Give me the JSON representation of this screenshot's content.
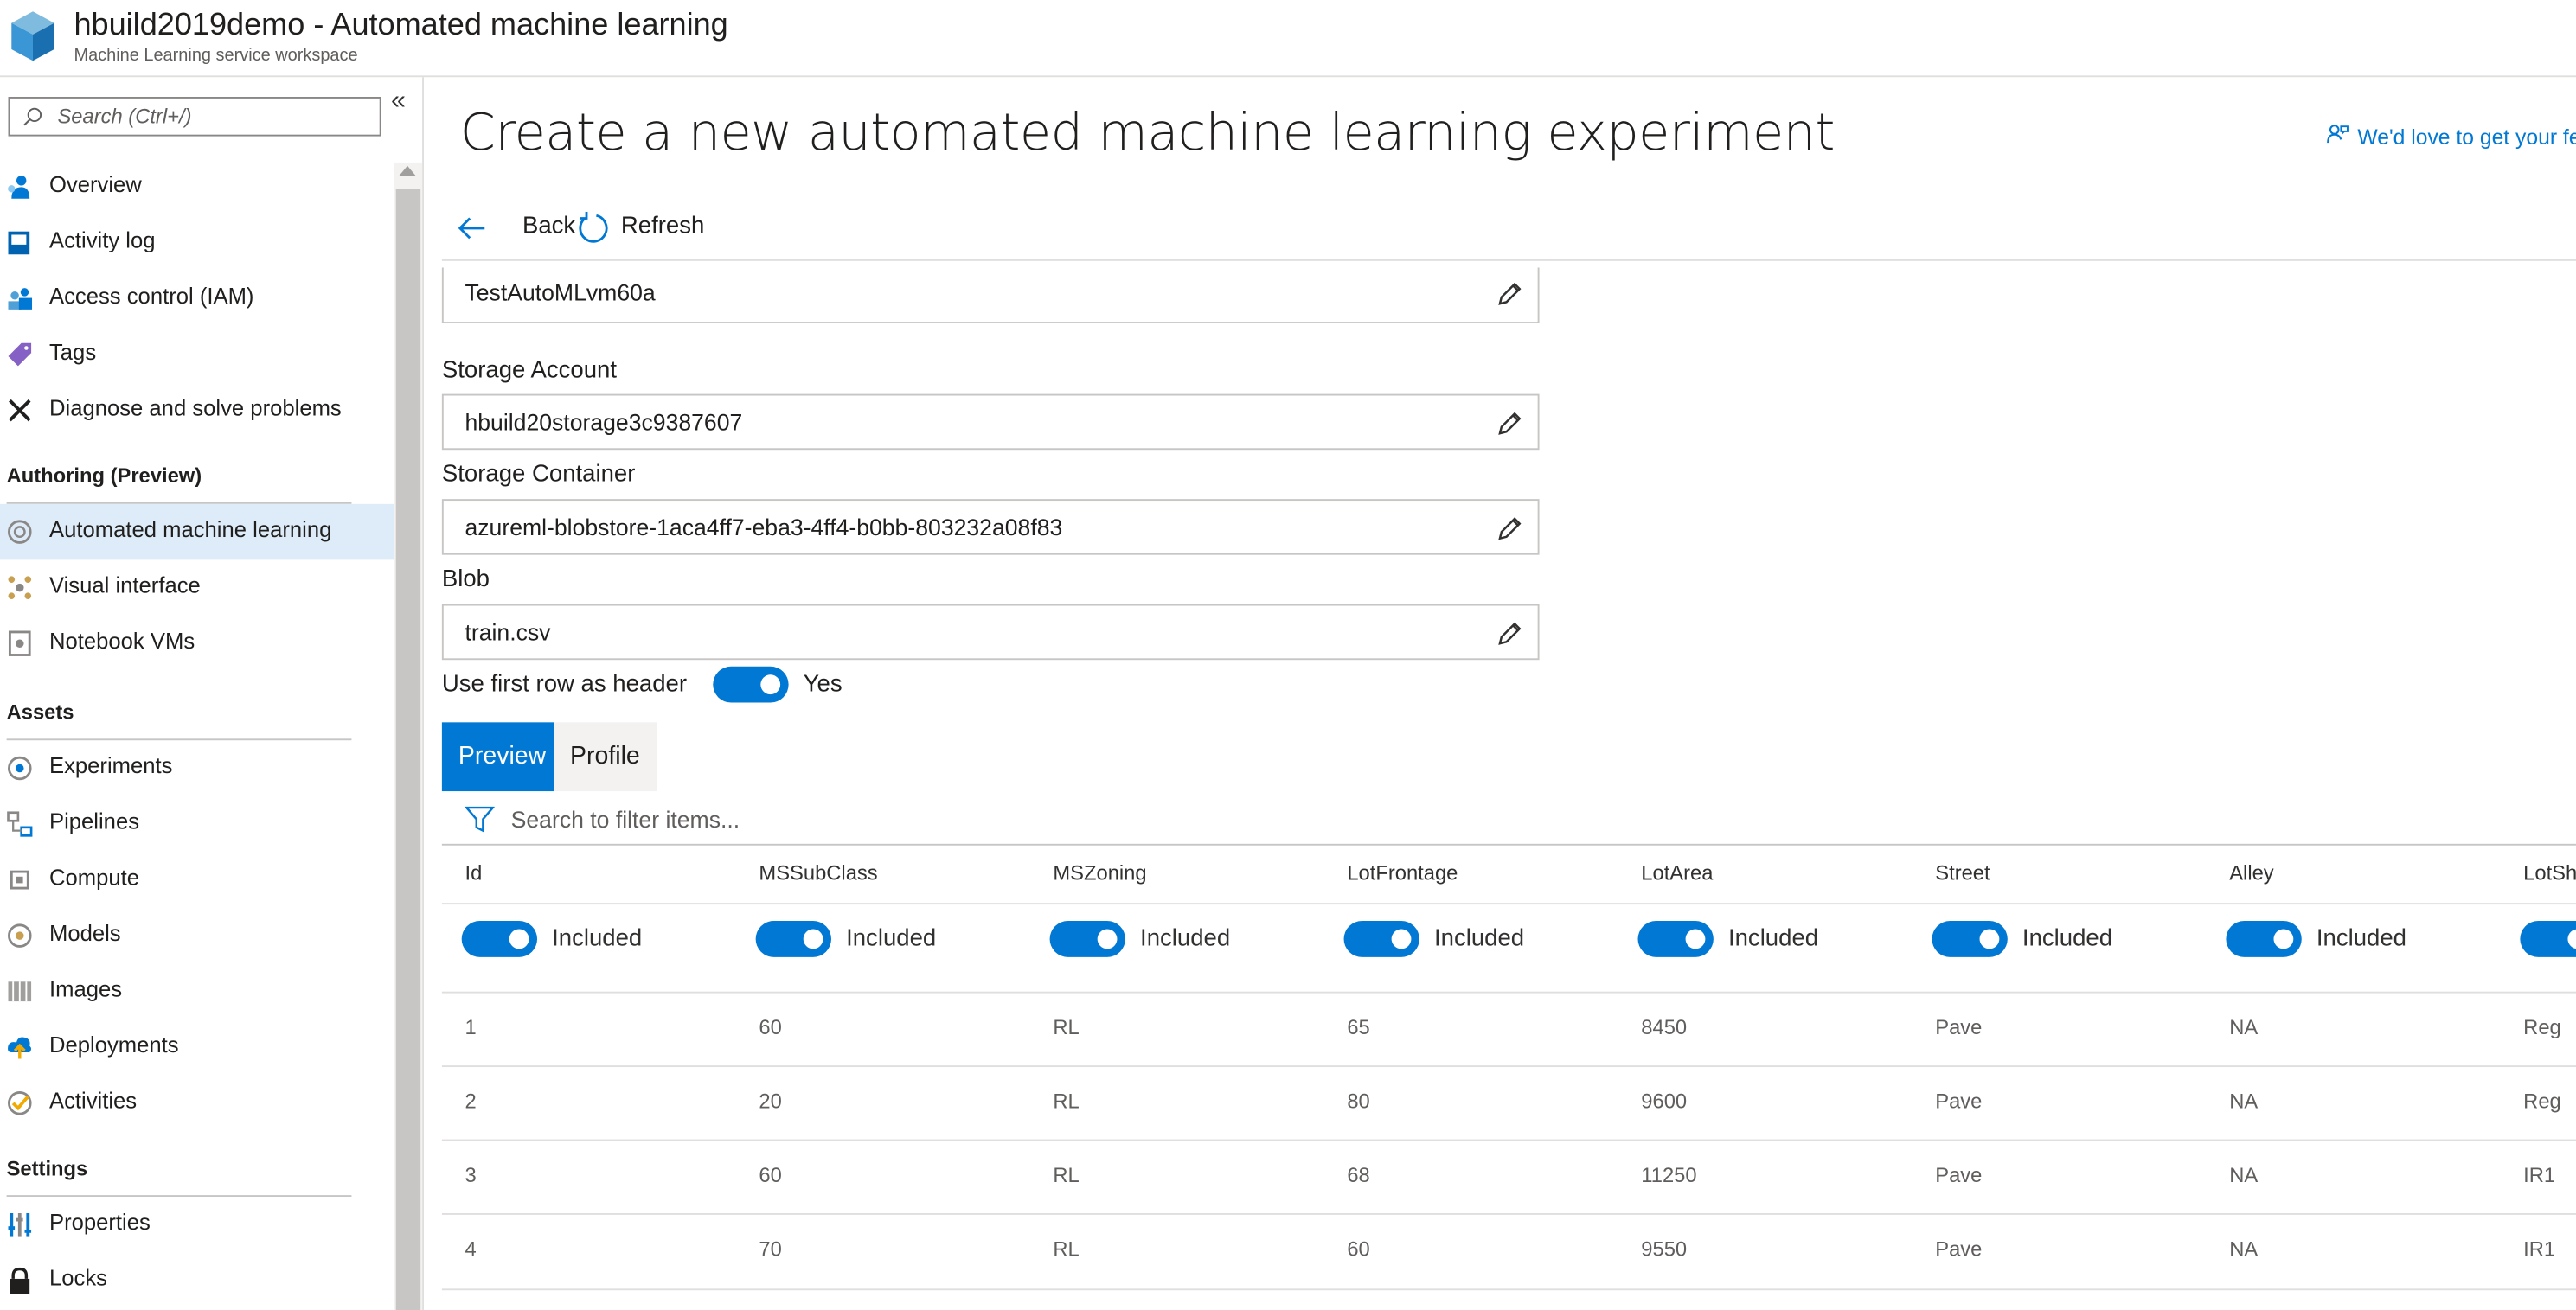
{
  "header": {
    "title": "hbuild2019demo - Automated machine learning",
    "subtitle": "Machine Learning service workspace"
  },
  "sidebar": {
    "search_placeholder": "Search (Ctrl+/)",
    "collapse_glyph": "«",
    "items": [
      {
        "label": "Overview",
        "icon": "overview-icon"
      },
      {
        "label": "Activity log",
        "icon": "activity-log-icon"
      },
      {
        "label": "Access control (IAM)",
        "icon": "access-control-icon"
      },
      {
        "label": "Tags",
        "icon": "tag-icon"
      },
      {
        "label": "Diagnose and solve problems",
        "icon": "wrench-icon"
      }
    ],
    "sections": [
      {
        "title": "Authoring (Preview)",
        "items": [
          {
            "label": "Automated machine learning",
            "icon": "automl-icon",
            "selected": true
          },
          {
            "label": "Visual interface",
            "icon": "visual-interface-icon"
          },
          {
            "label": "Notebook VMs",
            "icon": "notebook-icon"
          }
        ]
      },
      {
        "title": "Assets",
        "items": [
          {
            "label": "Experiments",
            "icon": "experiments-icon"
          },
          {
            "label": "Pipelines",
            "icon": "pipelines-icon"
          },
          {
            "label": "Compute",
            "icon": "compute-icon"
          },
          {
            "label": "Models",
            "icon": "models-icon"
          },
          {
            "label": "Images",
            "icon": "images-icon"
          },
          {
            "label": "Deployments",
            "icon": "deployments-icon"
          },
          {
            "label": "Activities",
            "icon": "activities-icon"
          }
        ]
      },
      {
        "title": "Settings",
        "items": [
          {
            "label": "Properties",
            "icon": "properties-icon"
          },
          {
            "label": "Locks",
            "icon": "lock-icon"
          }
        ]
      }
    ]
  },
  "main": {
    "title": "Create a new automated machine learning experiment",
    "feedback": "We'd love to get your fe",
    "commands": {
      "back": "Back",
      "refresh": "Refresh"
    },
    "fields": {
      "experiment_value": "TestAutoMLvm60a",
      "storage_account_label": "Storage Account",
      "storage_account_value": "hbuild20storage3c9387607",
      "storage_container_label": "Storage Container",
      "storage_container_value": "azureml-blobstore-1aca4ff7-eba3-4ff4-b0bb-803232a08f83",
      "blob_label": "Blob",
      "blob_value": "train.csv"
    },
    "header_toggle": {
      "label": "Use first row as header",
      "state": "Yes",
      "on": true
    },
    "tabs": [
      {
        "label": "Preview",
        "active": true
      },
      {
        "label": "Profile",
        "active": false
      }
    ],
    "filter_placeholder": "Search to filter items...",
    "table": {
      "columns": [
        "Id",
        "MSSubClass",
        "MSZoning",
        "LotFrontage",
        "LotArea",
        "Street",
        "Alley",
        "LotSha"
      ],
      "included_label": "Included",
      "rows": [
        [
          "1",
          "60",
          "RL",
          "65",
          "8450",
          "Pave",
          "NA",
          "Reg"
        ],
        [
          "2",
          "20",
          "RL",
          "80",
          "9600",
          "Pave",
          "NA",
          "Reg"
        ],
        [
          "3",
          "60",
          "RL",
          "68",
          "11250",
          "Pave",
          "NA",
          "IR1"
        ],
        [
          "4",
          "70",
          "RL",
          "60",
          "9550",
          "Pave",
          "NA",
          "IR1"
        ]
      ]
    }
  },
  "colors": {
    "accent": "#0078d4",
    "selected_bg": "#deecf9",
    "tab_inactive_bg": "#f3f2f1"
  }
}
